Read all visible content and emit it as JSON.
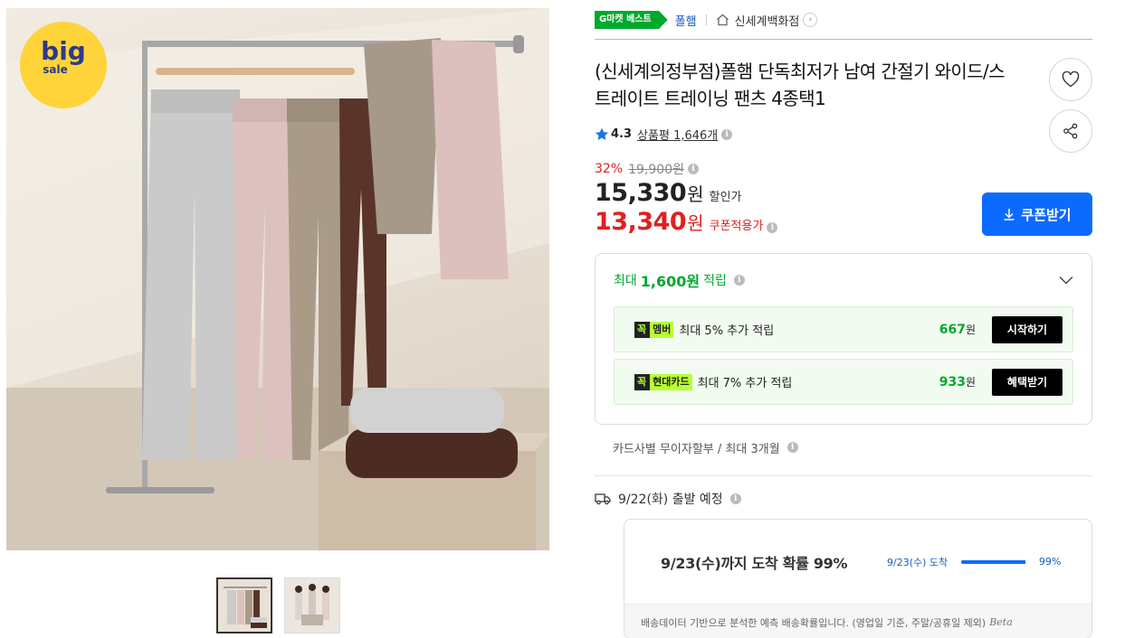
{
  "image": {
    "badge_big": "big",
    "badge_sale": "sale"
  },
  "breadcrumb": {
    "best_badge": "G마켓 베스트",
    "brand": "폴햄",
    "store": "신세계백화점"
  },
  "product": {
    "title": "(신세계의정부점)폴햄 단독최저가 남여 간절기 와이드/스트레이트 트레이닝 팬츠 4종택1",
    "rating": "4.3",
    "review_label": "상품평",
    "review_count": "1,646개"
  },
  "price": {
    "discount_pct": "32%",
    "original": "19,900원",
    "sale_price": "15,330",
    "sale_unit": "원",
    "sale_label": "할인가",
    "coupon_price": "13,340",
    "coupon_unit": "원",
    "coupon_label": "쿠폰적용가",
    "coupon_button": "쿠폰받기"
  },
  "reward": {
    "prefix": "최대",
    "amount": "1,600원",
    "suffix": "적립",
    "rows": [
      {
        "kkok": "꼭",
        "tag": "멤버",
        "text": "최대 5% 추가 적립",
        "amount": "667",
        "unit": "원",
        "button": "시작하기"
      },
      {
        "kkok": "꼭",
        "tag": "현대카드",
        "text": "최대 7% 추가 적립",
        "amount": "933",
        "unit": "원",
        "button": "혜택받기"
      }
    ]
  },
  "installment": "카드사별 무이자할부 / 최대 3개월",
  "shipping": {
    "depart": "9/22(화) 출발 예정",
    "arrive_text": "9/23(수)까지 도착 확률 99%",
    "arrive_date": "9/23(수) 도착",
    "arrive_pct": "99%",
    "arrive_fraction": 0.99,
    "footnote": "배송데이터 기반으로 분석한 예측 배송확률입니다. (영업일 기준, 주말/공휴일 제외)",
    "beta": "Beta"
  },
  "colors": {
    "accent_green": "#00a82d",
    "price_red": "#e02020",
    "button_blue": "#0c6bfe",
    "kkok_green": "#b6ff34"
  }
}
